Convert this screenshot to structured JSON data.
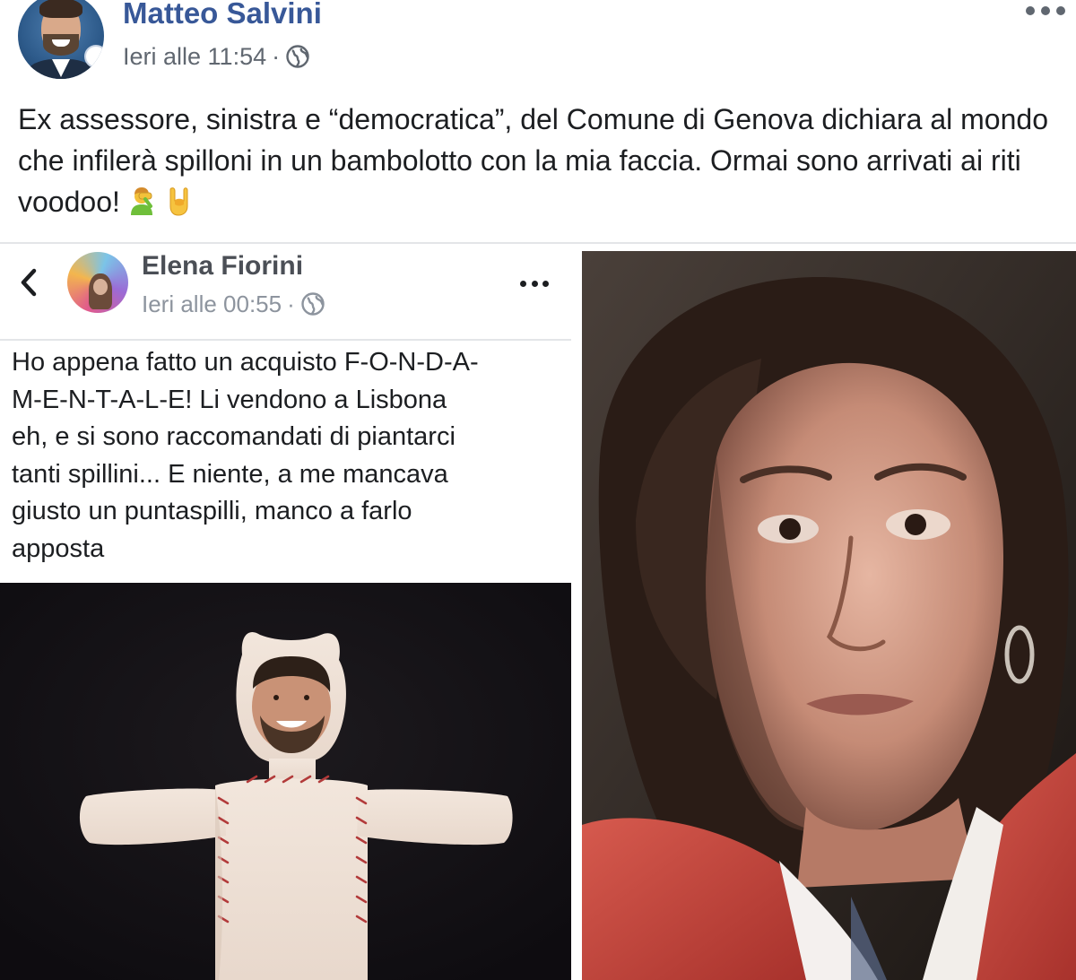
{
  "post": {
    "author_name": "Matteo Salvini",
    "timestamp": "Ieri alle 11:54",
    "separator": "·",
    "privacy_icon": "globe-icon",
    "text": "Ex assessore, sinistra e “democratica”, del Comune di Genova dichiara al mondo che infilerà spilloni in un bambolotto con la mia faccia. Ormai sono arrivati ai riti voodoo!",
    "emojis": [
      "man-facepalming-emoji",
      "sign-of-the-horns-emoji"
    ]
  },
  "shared_post": {
    "back_icon": "chevron-left-icon",
    "author_name": "Elena Fiorini",
    "timestamp": "Ieri alle 00:55",
    "separator": "·",
    "privacy_icon": "globe-icon",
    "text": "Ho appena fatto un acquisto F-O-N-D-A-\nM-E-N-T-A-L-E! Li vendono a Lisbona\neh, e si sono raccomandati di piantarci\ntanti spillini... E niente, a me mancava\ngiusto un puntaspilli, manco a farlo\napposta"
  },
  "colors": {
    "author_link": "#385898",
    "meta_text": "#606770",
    "body_text": "#1c1e21",
    "divider": "#e3e5e8"
  }
}
